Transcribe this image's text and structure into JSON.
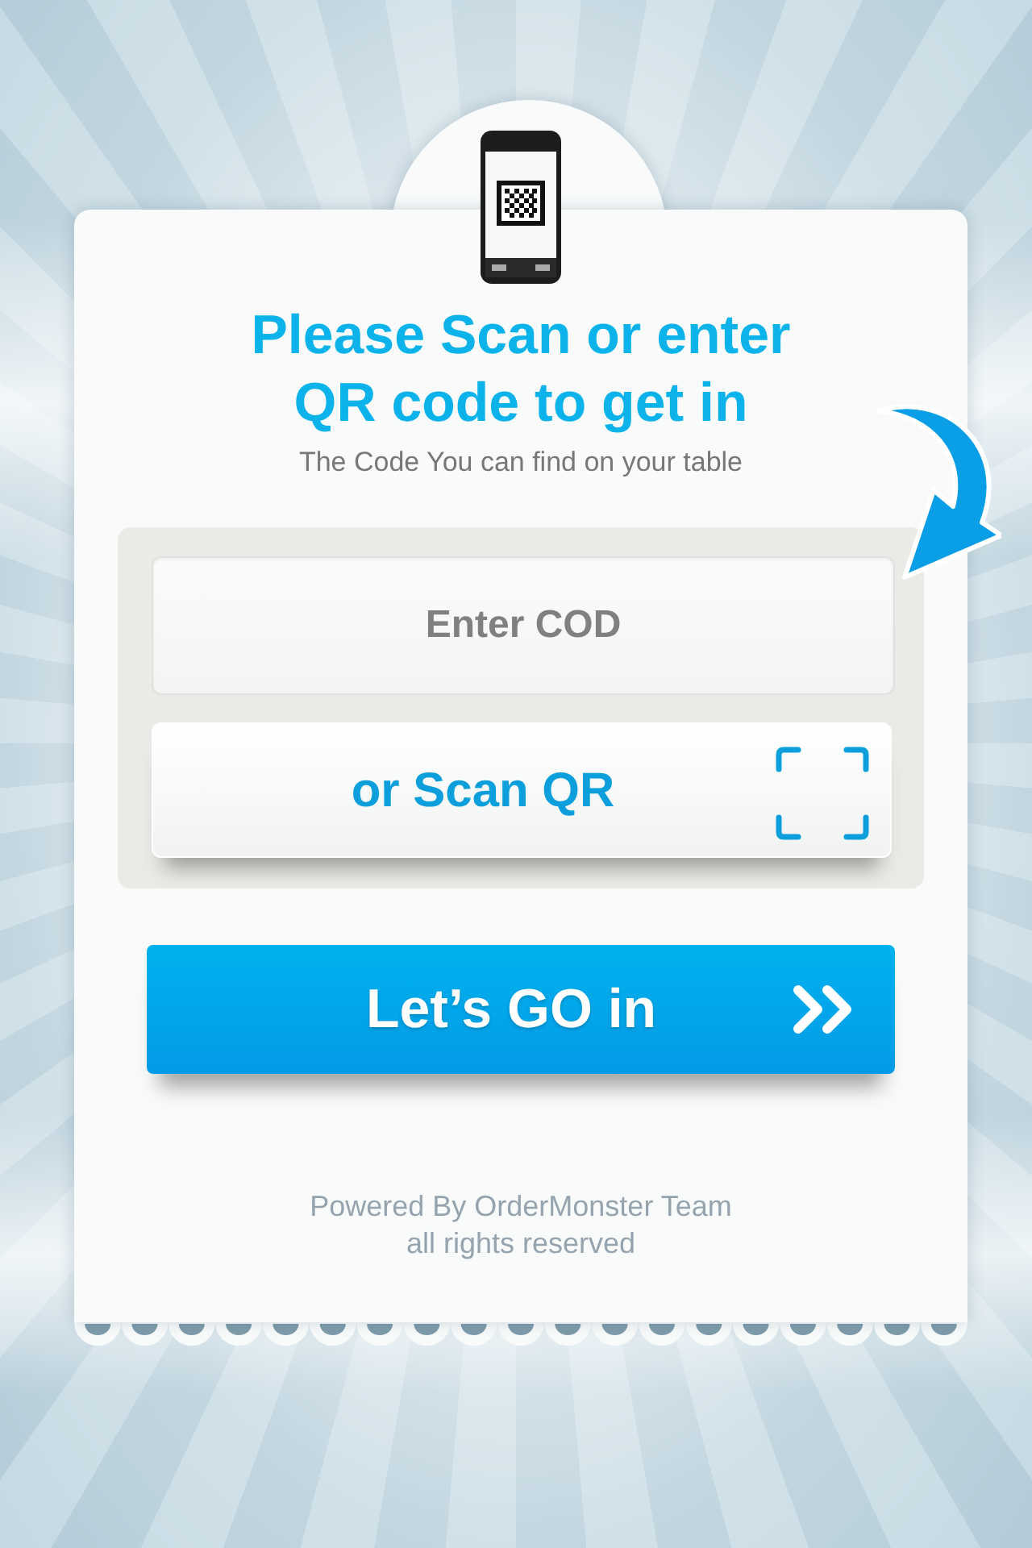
{
  "header": {
    "title": "Please Scan or enter QR code to get in",
    "subtitle": "The Code You can find on your table"
  },
  "code_field": {
    "placeholder": "Enter COD"
  },
  "scan_button": {
    "label": "or Scan QR"
  },
  "go_button": {
    "label": "Let’s GO in"
  },
  "footer": {
    "lines": [
      "Powered By OrderMonster Team",
      "all rights reserved"
    ]
  }
}
